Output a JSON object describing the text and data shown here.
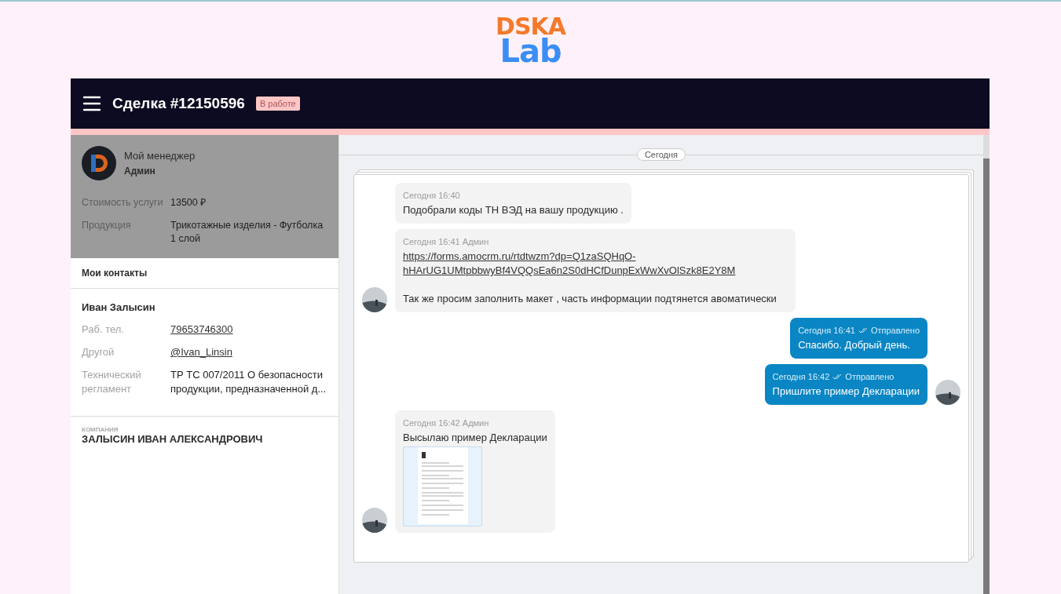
{
  "logo": {
    "top": "DSKA",
    "bottom": "Lab"
  },
  "header": {
    "title": "Сделка #12150596",
    "status": "В работе"
  },
  "manager": {
    "label": "Мой менеджер",
    "name": "Админ"
  },
  "deal_fields": [
    {
      "label": "Стоимость услуги",
      "value": "13500 ₽"
    },
    {
      "label": "Продукция",
      "value": "Трикотажные изделия - Футболка 1 слой"
    }
  ],
  "contacts": {
    "title": "Мои контакты",
    "name": "Иван Залысин",
    "fields": [
      {
        "label": "Раб. тел.",
        "value": "79653746300",
        "kind": "link"
      },
      {
        "label": "Другой",
        "value": "@Ivan_Linsin",
        "kind": "link"
      },
      {
        "label": "Технический регламент",
        "value": "ТР ТС 007/2011 О безопасности продукции, предназначенной д...",
        "kind": "text"
      }
    ]
  },
  "company": {
    "label": "КОМПАНИЯ",
    "name": "ЗАЛЫСИН ИВАН АЛЕКСАНДРОВИЧ"
  },
  "chat": {
    "date": "Сегодня",
    "messages": [
      {
        "kind": "incoming",
        "meta": "Сегодня 16:40",
        "text": "Подобрали коды ТН ВЭД на вашу продукцию .",
        "show_avatar": false
      },
      {
        "kind": "incoming",
        "meta": "Сегодня 16:41 Админ",
        "link": "https://forms.amocrm.ru/rtdtwzm?dp=Q1zaSQHqO-hHArUG1UMtpbbwyBf4VQQsEa6n2S0dHCfDunpExWwXvOlSzk8E2Y8M",
        "text": "Так же просим заполнить макет , часть информации подтянется авоматически",
        "show_avatar": true
      },
      {
        "kind": "outgoing",
        "meta": "Сегодня 16:41",
        "status": "Отправлено",
        "text": "Спасибо. Добрый день.",
        "show_avatar": false
      },
      {
        "kind": "outgoing",
        "meta": "Сегодня 16:42",
        "status": "Отправлено",
        "text": "Пришлите пример Декларации",
        "show_avatar": true
      },
      {
        "kind": "incoming",
        "meta": "Сегодня 16:42 Админ",
        "text": "Высылаю пример Декларации",
        "attachment": true,
        "show_avatar": true
      }
    ]
  }
}
